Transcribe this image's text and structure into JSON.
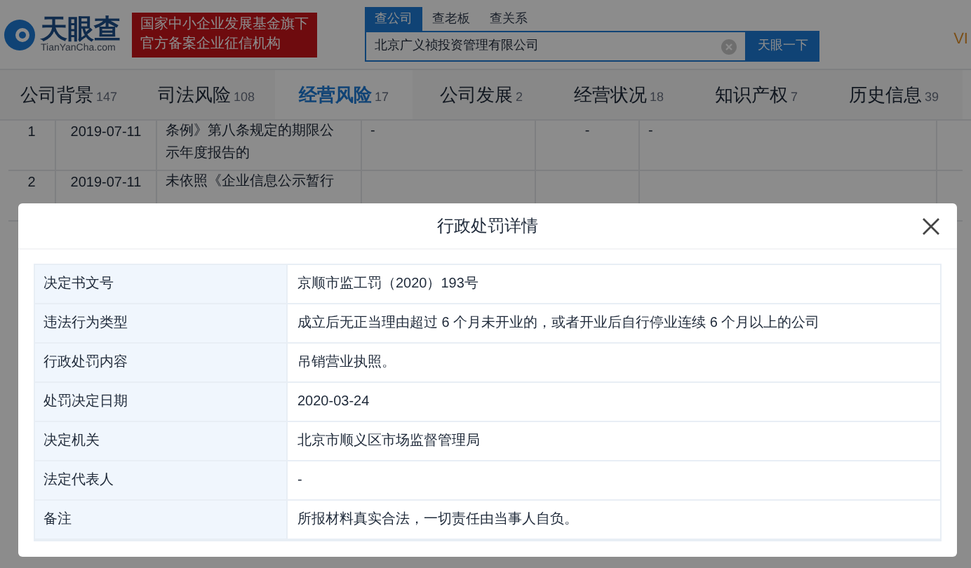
{
  "header": {
    "logo_text": "天眼查",
    "logo_sub": "TianYanCha.com",
    "badge_lines": [
      "国家中小企业发展基金旗下",
      "官方备案企业征信机构"
    ],
    "search_tabs": [
      {
        "label": "查公司",
        "selected": true
      },
      {
        "label": "查老板",
        "selected": false
      },
      {
        "label": "查关系",
        "selected": false
      }
    ],
    "search_value": "北京广义祯投资管理有限公司",
    "search_button": "天眼一下",
    "right_text": "VI"
  },
  "tabs": [
    {
      "label": "公司背景",
      "count": "147",
      "selected": false
    },
    {
      "label": "司法风险",
      "count": "108",
      "selected": false
    },
    {
      "label": "经营风险",
      "count": "17",
      "selected": true
    },
    {
      "label": "公司发展",
      "count": "2",
      "selected": false
    },
    {
      "label": "经营状况",
      "count": "18",
      "selected": false
    },
    {
      "label": "知识产权",
      "count": "7",
      "selected": false
    },
    {
      "label": "历史信息",
      "count": "39",
      "selected": false
    }
  ],
  "table_rows": [
    {
      "index": "1",
      "date": "2019-07-11",
      "reason": [
        "条例》第八条规定的期限公",
        "示年度报告的"
      ],
      "column_4": "-",
      "column_5": "-",
      "column_6": "-"
    },
    {
      "index": "2",
      "date": "2019-07-11",
      "reason": [
        "未依照《企业信息公示暂行"
      ],
      "column_4": "",
      "column_5": "",
      "column_6": ""
    }
  ],
  "modal": {
    "title": "行政处罚详情",
    "rows": [
      {
        "label": "决定书文号",
        "value": "京顺市监工罚（2020）193号"
      },
      {
        "label": "违法行为类型",
        "value": "成立后无正当理由超过 6 个月未开业的，或者开业后自行停业连续 6 个月以上的公司"
      },
      {
        "label": "行政处罚内容",
        "value": "吊销营业执照。"
      },
      {
        "label": "处罚决定日期",
        "value": "2020-03-24"
      },
      {
        "label": "决定机关",
        "value": "北京市顺义区市场监督管理局"
      },
      {
        "label": "法定代表人",
        "value": "-"
      },
      {
        "label": "备注",
        "value": "所报材料真实合法，一切责任由当事人自负。"
      }
    ]
  }
}
